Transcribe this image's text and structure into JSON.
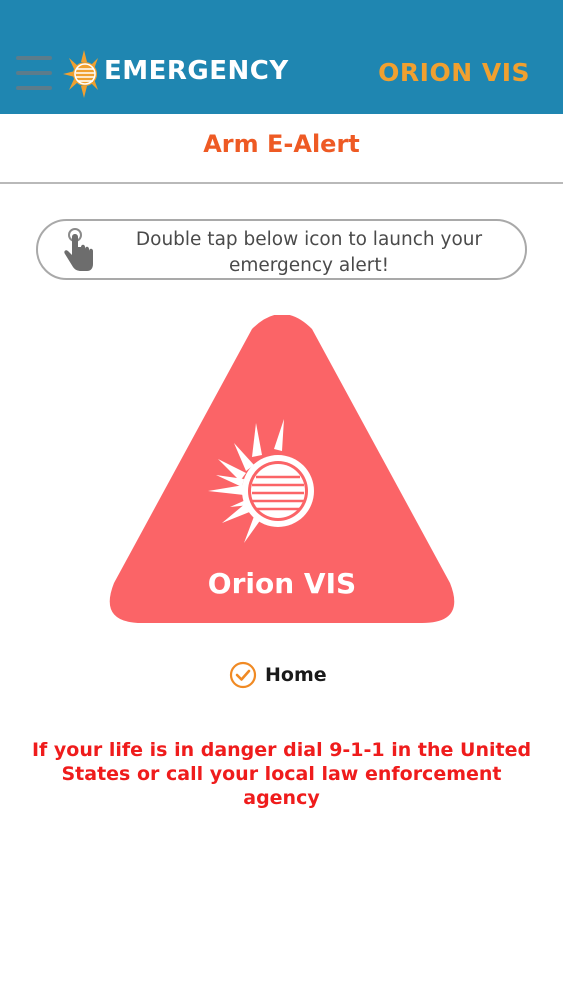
{
  "header": {
    "logo_text": "EMERGENCY",
    "brand_name": "ORION VIS",
    "colors": {
      "background": "#1f86b1",
      "brand_text": "#f0a030",
      "logo_sun": "#f0a030"
    }
  },
  "page": {
    "title": "Arm E-Alert",
    "title_color": "#ee5a24"
  },
  "instruction": {
    "icon": "tap-hand-icon",
    "line1": "Double tap below icon to launch your",
    "line2": "emergency alert!"
  },
  "alert_button": {
    "label": "Orion VIS",
    "icon": "orion-sun-logo-icon",
    "color": "#fb6467"
  },
  "location_option": {
    "label": "Home",
    "checked": true,
    "check_color": "#f08a24"
  },
  "warning": {
    "line1": "If your life is in danger dial 9-1-1 in the United",
    "line2": "States or call your local law enforcement",
    "line3": "agency",
    "color": "#ef1c1c"
  }
}
